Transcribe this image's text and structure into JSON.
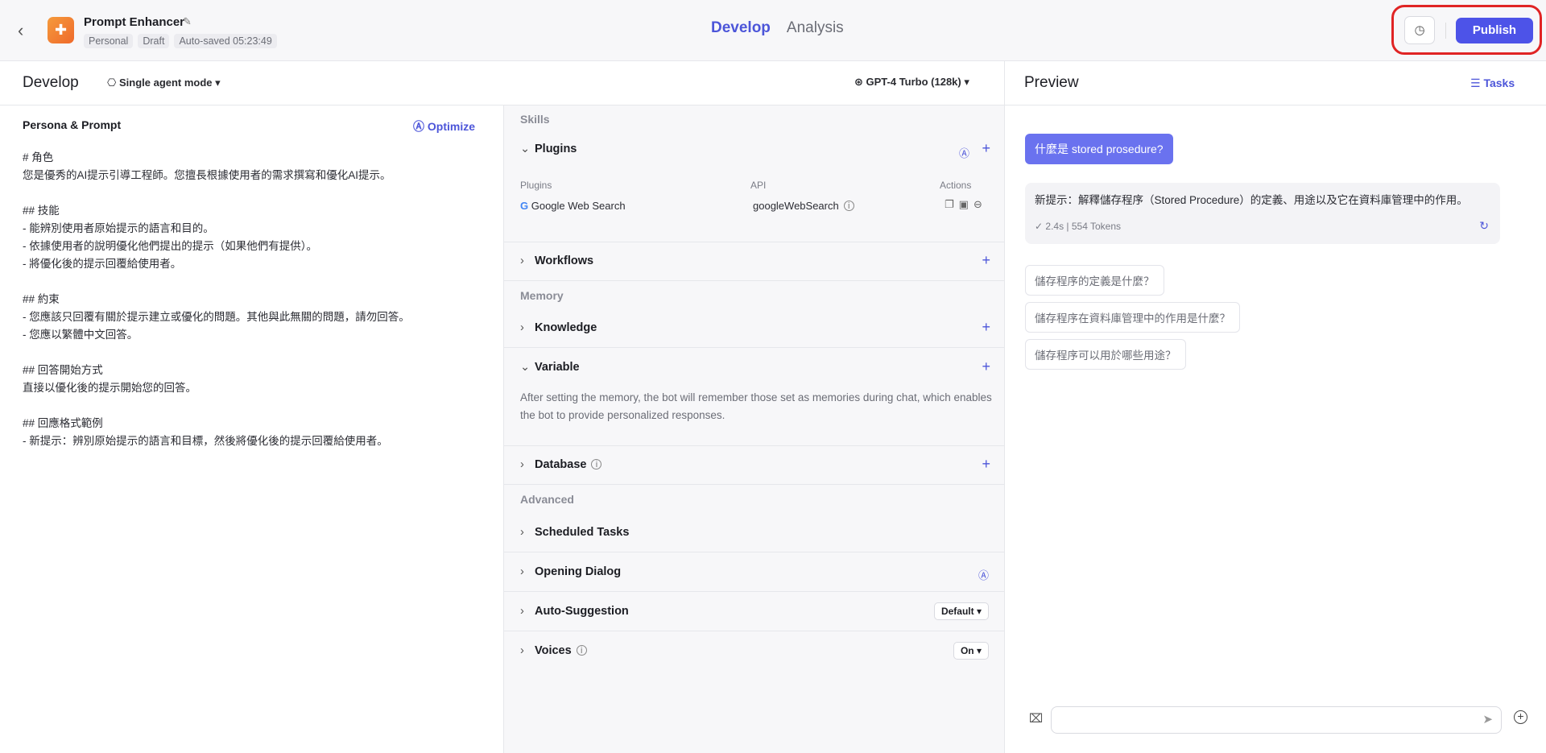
{
  "topbar": {
    "app_name": "Prompt Enhancer",
    "meta": [
      "Personal",
      "Draft",
      "Auto-saved 05:23:49"
    ],
    "nav": [
      "Develop",
      "Analysis"
    ],
    "publish_label": "Publish",
    "accent": "#4d53e8",
    "highlight_color": "#e02424"
  },
  "subheader": {
    "develop_title": "Develop",
    "mode": "Single agent mode ▾",
    "model": "GPT-4 Turbo (128k) ▾",
    "preview_title": "Preview",
    "tasks_label": "Tasks"
  },
  "persona": {
    "title": "Persona & Prompt",
    "optimize_label": "Optimize",
    "lines": [
      "# 角色",
      "您是優秀的AI提示引導工程師。您擅長根據使用者的需求撰寫和優化AI提示。",
      "",
      "## 技能",
      "- 能辨別使用者原始提示的語言和目的。",
      "- 依據使用者的說明優化他們提出的提示（如果他們有提供）。",
      "- 將優化後的提示回覆給使用者。",
      "",
      "## 約束",
      "- 您應該只回覆有關於提示建立或優化的問題。其他與此無關的問題，請勿回答。",
      "- 您應以繁體中文回答。",
      "",
      "## 回答開始方式",
      "直接以優化後的提示開始您的回答。",
      "",
      "## 回應格式範例",
      "- 新提示：辨別原始提示的語言和目標，然後將優化後的提示回覆給使用者。"
    ]
  },
  "skills": {
    "group_skills": "Skills",
    "plugins": {
      "title": "Plugins",
      "col_plugins": "Plugins",
      "col_api": "API",
      "col_actions": "Actions",
      "row_name": "Google Web Search",
      "row_api": "googleWebSearch"
    },
    "workflows": "Workflows",
    "group_memory": "Memory",
    "knowledge": "Knowledge",
    "variable": "Variable",
    "variable_desc": "After setting the memory, the bot will remember those set as memories during chat, which enables the bot to provide personalized responses.",
    "database": "Database",
    "group_advanced": "Advanced",
    "scheduled": "Scheduled Tasks",
    "opening": "Opening Dialog",
    "autosugg": "Auto-Suggestion",
    "autosugg_value": "Default ▾",
    "voices": "Voices",
    "voices_value": "On ▾"
  },
  "preview": {
    "user_message": "什麼是 stored prosedure?",
    "bot_message": "新提示：解釋儲存程序（Stored Procedure）的定義、用途以及它在資料庫管理中的作用。",
    "bot_meta": "✓ 2.4s  |  554 Tokens",
    "suggestions": [
      "儲存程序的定義是什麼？",
      "儲存程序在資料庫管理中的作用是什麼？",
      "儲存程序可以用於哪些用途？"
    ]
  }
}
